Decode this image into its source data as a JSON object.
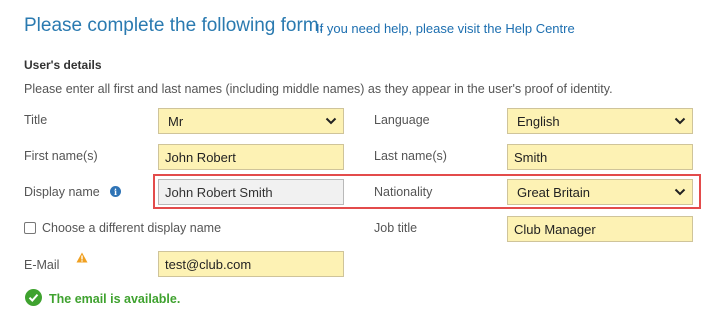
{
  "header": {
    "title": "Please complete the following form.",
    "help_link": "If you need help, please visit the Help Centre"
  },
  "section": {
    "title": "User's details",
    "instructions": "Please enter all first and last names (including middle names) as they appear in the user's proof of identity."
  },
  "fields": {
    "title": {
      "label": "Title",
      "value": "Mr"
    },
    "language": {
      "label": "Language",
      "value": "English"
    },
    "first_name": {
      "label": "First name(s)",
      "value": "John Robert"
    },
    "last_name": {
      "label": "Last name(s)",
      "value": "Smith"
    },
    "display_name": {
      "label": "Display name",
      "value": "John Robert Smith"
    },
    "nationality": {
      "label": "Nationality",
      "value": "Great Britain"
    },
    "different_display_name": {
      "label": "Choose a different display name",
      "checked": false
    },
    "job_title": {
      "label": "Job title",
      "value": "Club Manager"
    },
    "email": {
      "label": "E-Mail",
      "value": "test@club.com"
    }
  },
  "email_status": {
    "message": "The email is available."
  },
  "colors": {
    "title": "#2a7ab0",
    "link": "#1d6fb0",
    "field_bg": "#fdf2b4",
    "readonly_bg": "#f1f1f1",
    "highlight": "#e34b4b",
    "success": "#3fa22f",
    "warning": "#f0a020",
    "info": "#2f74b6"
  },
  "icons": [
    "info-icon",
    "warning-icon",
    "check-circle-icon",
    "chevron-down-icon"
  ]
}
